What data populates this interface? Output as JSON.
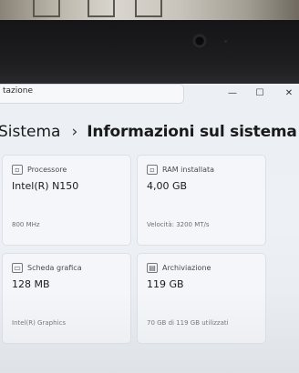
{
  "window": {
    "title_fragment": "tazione",
    "controls": {
      "minimize": "—",
      "maximize": "☐",
      "close": "✕"
    }
  },
  "breadcrumb": {
    "parent": "Sistema",
    "separator": "›",
    "current": "Informazioni sul sistema"
  },
  "cards": [
    {
      "title": "Processore",
      "icon": "processor-icon",
      "value": "Intel(R) N150",
      "detail": "800 MHz"
    },
    {
      "title": "RAM installata",
      "icon": "ram-icon",
      "value": "4,00 GB",
      "detail": "Velocità: 3200 MT/s"
    },
    {
      "title": "Scheda grafica",
      "icon": "graphics-card-icon",
      "value": "128 MB",
      "detail": "Intel(R) Graphics"
    },
    {
      "title": "Archiviazione",
      "icon": "storage-icon",
      "value": "119 GB",
      "detail": "70 GB di 119 GB utilizzati"
    }
  ]
}
